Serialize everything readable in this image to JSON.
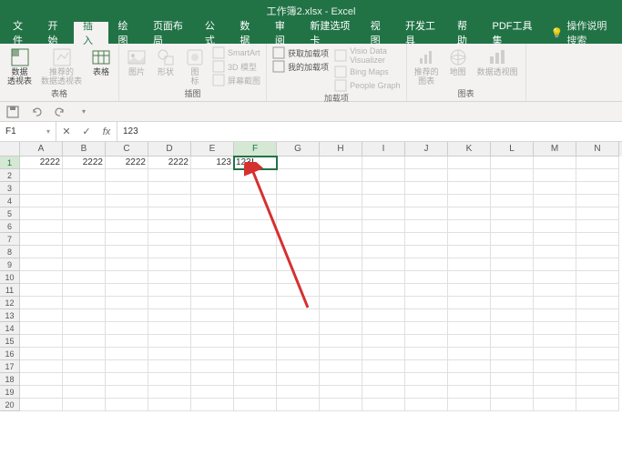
{
  "app": {
    "title": "工作簿2.xlsx - Excel"
  },
  "tabs": [
    {
      "label": "文件"
    },
    {
      "label": "开始"
    },
    {
      "label": "插入"
    },
    {
      "label": "绘图"
    },
    {
      "label": "页面布局"
    },
    {
      "label": "公式"
    },
    {
      "label": "数据"
    },
    {
      "label": "审阅"
    },
    {
      "label": "新建选项卡"
    },
    {
      "label": "视图"
    },
    {
      "label": "开发工具"
    },
    {
      "label": "帮助"
    },
    {
      "label": "PDF工具集"
    }
  ],
  "active_tab": 2,
  "tell_me": "操作说明搜索",
  "ribbon": {
    "groups": [
      {
        "name": "tables",
        "label": "表格",
        "items": [
          {
            "type": "big",
            "name": "pivot-table",
            "label": "数据\n透视表",
            "icon": "pivot"
          },
          {
            "type": "big",
            "name": "recommended-pivot",
            "label": "推荐的\n数据透视表",
            "icon": "pivot-rec",
            "disabled": true
          },
          {
            "type": "big",
            "name": "table",
            "label": "表格",
            "icon": "table"
          }
        ]
      },
      {
        "name": "illustrations",
        "label": "插图",
        "items": [
          {
            "type": "big",
            "name": "pictures",
            "label": "图片",
            "icon": "picture",
            "disabled": true
          },
          {
            "type": "big",
            "name": "shapes",
            "label": "形状",
            "icon": "shapes",
            "disabled": true
          },
          {
            "type": "big",
            "name": "icons",
            "label": "图\n标",
            "icon": "icons",
            "disabled": true
          },
          {
            "type": "small-list",
            "items": [
              {
                "name": "smartart",
                "label": "SmartArt",
                "icon": "smartart",
                "disabled": true
              },
              {
                "name": "3dmodel",
                "label": "3D 模型",
                "icon": "3d",
                "disabled": true
              },
              {
                "name": "screenshot",
                "label": "屏幕截图",
                "icon": "screenshot",
                "disabled": true
              }
            ]
          }
        ]
      },
      {
        "name": "addins",
        "label": "加载项",
        "items": [
          {
            "type": "small-list",
            "items": [
              {
                "name": "get-addins",
                "label": "获取加载项",
                "icon": "store"
              },
              {
                "name": "my-addins",
                "label": "我的加载项",
                "icon": "addin"
              }
            ]
          },
          {
            "type": "small-list",
            "items": [
              {
                "name": "visio",
                "label": "Visio Data\nVisualizer",
                "icon": "visio",
                "disabled": true
              },
              {
                "name": "bing-maps",
                "label": "Bing Maps",
                "icon": "bing",
                "disabled": true
              },
              {
                "name": "people-graph",
                "label": "People Graph",
                "icon": "people",
                "disabled": true
              }
            ]
          }
        ]
      },
      {
        "name": "charts",
        "label": "图表",
        "items": [
          {
            "type": "big",
            "name": "recommended-charts",
            "label": "推荐的\n图表",
            "icon": "chart-rec",
            "disabled": true
          },
          {
            "type": "big",
            "name": "maps",
            "label": "地图",
            "icon": "map",
            "disabled": true
          },
          {
            "type": "big",
            "name": "pivot-chart",
            "label": "数据透视图",
            "icon": "pivot-chart",
            "disabled": true
          }
        ]
      }
    ]
  },
  "name_box": "F1",
  "formula_value": "123",
  "columns": [
    "A",
    "B",
    "C",
    "D",
    "E",
    "F",
    "G",
    "H",
    "I",
    "J",
    "K",
    "L",
    "M",
    "N"
  ],
  "active_col": "F",
  "active_row": 1,
  "row_count": 20,
  "cells": {
    "A1": "2222",
    "B1": "2222",
    "C1": "2222",
    "D1": "2222",
    "E1": "123",
    "F1": "123"
  }
}
